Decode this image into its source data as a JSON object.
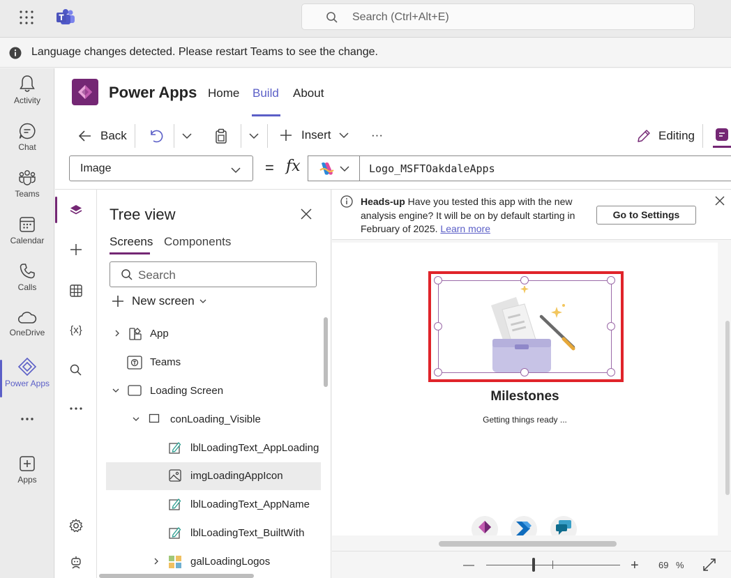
{
  "teams": {
    "search_placeholder": "Search (Ctrl+Alt+E)",
    "banner_text": "Language changes detected. Please restart Teams to see the change.",
    "rail": [
      {
        "label": "Activity",
        "icon": "bell-icon"
      },
      {
        "label": "Chat",
        "icon": "chat-icon"
      },
      {
        "label": "Teams",
        "icon": "teams-icon"
      },
      {
        "label": "Calendar",
        "icon": "calendar-icon"
      },
      {
        "label": "Calls",
        "icon": "phone-icon"
      },
      {
        "label": "OneDrive",
        "icon": "cloud-icon"
      },
      {
        "label": "Power Apps",
        "icon": "power-apps-icon"
      },
      {
        "label": "Apps",
        "icon": "add-apps-icon"
      }
    ]
  },
  "powerapps": {
    "title": "Power Apps",
    "tabs": [
      "Home",
      "Build",
      "About"
    ],
    "active_tab": "Build",
    "accent": "#5b5fc7",
    "brand": "#742774"
  },
  "commands": {
    "back": "Back",
    "insert": "Insert",
    "more": "···",
    "editing": "Editing"
  },
  "formula": {
    "property": "Image",
    "equals": "=",
    "fx": "fx",
    "value": "Logo_MSFTOakdaleApps"
  },
  "tree": {
    "title": "Tree view",
    "tabs": [
      "Screens",
      "Components"
    ],
    "search_placeholder": "Search",
    "new_screen": "New screen",
    "items": [
      {
        "label": "App"
      },
      {
        "label": "Teams"
      },
      {
        "label": "Loading Screen"
      },
      {
        "label": "conLoading_Visible"
      },
      {
        "label": "lblLoadingText_AppLoading"
      },
      {
        "label": "imgLoadingAppIcon",
        "selected": true
      },
      {
        "label": "lblLoadingText_AppName"
      },
      {
        "label": "lblLoadingText_BuiltWith"
      },
      {
        "label": "galLoadingLogos"
      }
    ]
  },
  "headsup": {
    "bold": "Heads-up",
    "text": " Have you tested this app with the new analysis engine? It will be on by default starting in February of 2025. ",
    "link": "Learn more",
    "button": "Go to Settings"
  },
  "canvas": {
    "app_name": "Milestones",
    "loading_text": "Getting things ready ...",
    "selection_color": "#e0242a"
  },
  "zoom": {
    "minus": "—",
    "plus": "+",
    "value": "69",
    "unit": "%",
    "level_percent": 69
  }
}
